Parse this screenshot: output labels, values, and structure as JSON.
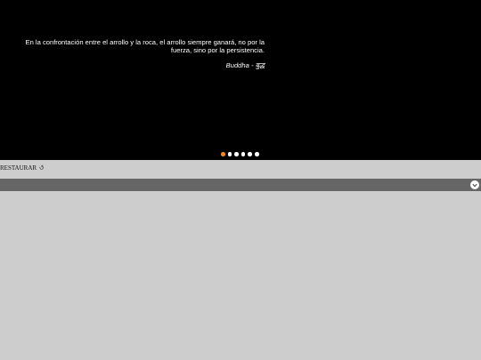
{
  "hero": {
    "quote": "En la confrontación entre el arrollo y la roca, el arrollo siempre ganará, no por la fuerza, sino por la persistencia.",
    "author": "Buddha - बुद्ध",
    "background": "#000000",
    "slides": {
      "count": 6,
      "active_index": 0,
      "active_color": "#f08a24",
      "inactive_color": "#ffffff"
    }
  },
  "controls": {
    "restore_label": "RESTAURAR",
    "restore_icon": "undo-arrow-icon"
  },
  "bar": {
    "background": "#666666",
    "toggle_icon": "chevron-down-icon"
  },
  "page": {
    "background": "#cdcdcd"
  }
}
